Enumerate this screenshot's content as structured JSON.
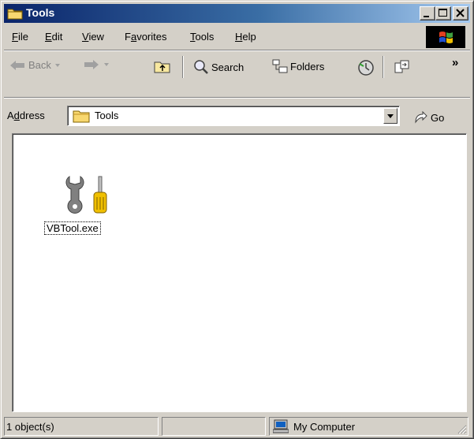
{
  "window": {
    "title": "Tools"
  },
  "menu": {
    "items": [
      {
        "pre": "",
        "key": "F",
        "post": "ile"
      },
      {
        "pre": "",
        "key": "E",
        "post": "dit"
      },
      {
        "pre": "",
        "key": "V",
        "post": "iew"
      },
      {
        "pre": "F",
        "key": "a",
        "post": "vorites"
      },
      {
        "pre": "",
        "key": "T",
        "post": "ools"
      },
      {
        "pre": "",
        "key": "H",
        "post": "elp"
      }
    ]
  },
  "toolbar": {
    "back_label": "Back",
    "search_label": "Search",
    "folders_label": "Folders",
    "more_glyph": "»"
  },
  "address": {
    "label_pre": "A",
    "label_key": "d",
    "label_post": "dress",
    "value": "Tools",
    "go_label": "Go"
  },
  "content": {
    "files": [
      {
        "name": "VBTool.exe",
        "icon": "tools-icon"
      }
    ]
  },
  "status": {
    "objects": "1 object(s)",
    "zone": "My Computer"
  }
}
